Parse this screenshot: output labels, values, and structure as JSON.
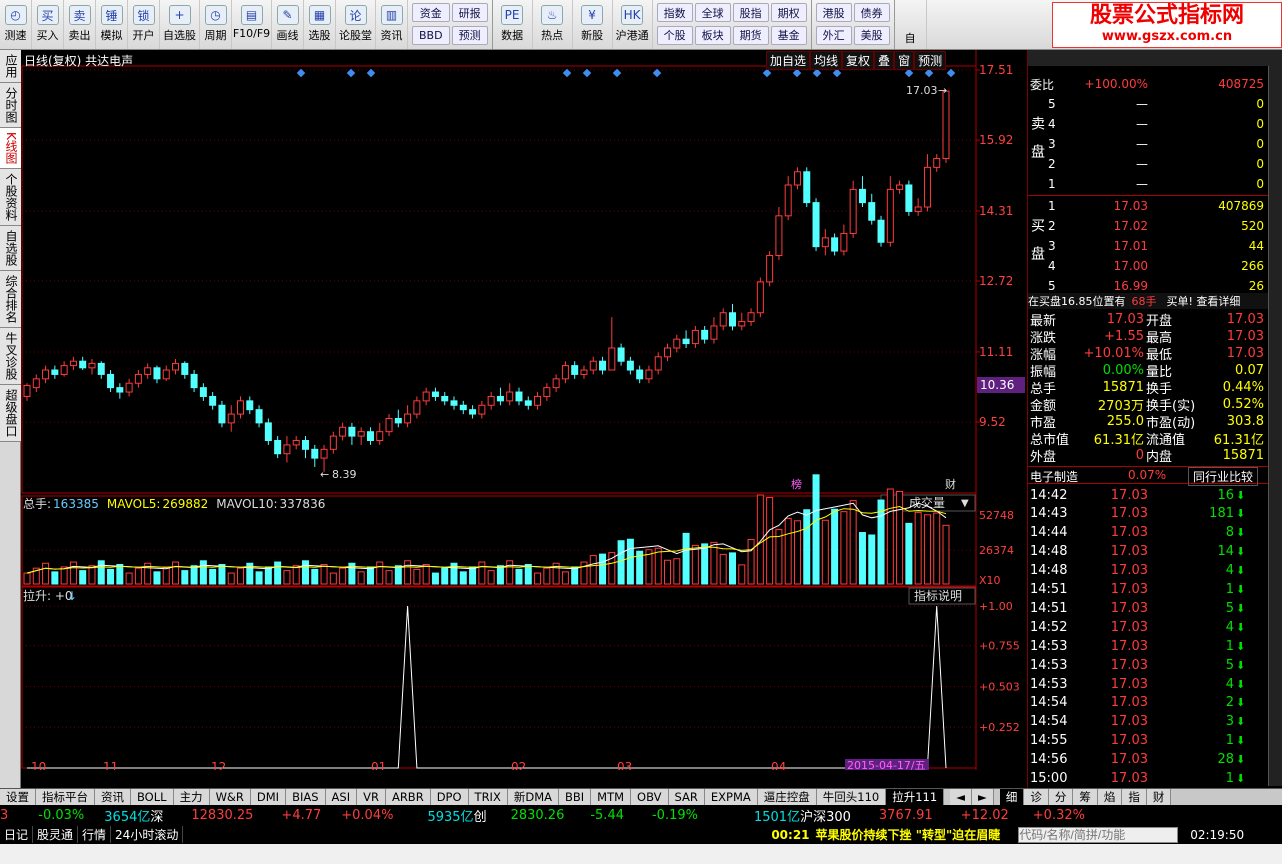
{
  "toolbar": {
    "buttons": [
      {
        "label": "测速",
        "icon": "clock-icon"
      },
      {
        "label": "买入",
        "icon": "buy-icon",
        "glyph": "买"
      },
      {
        "label": "卖出",
        "icon": "sell-icon",
        "glyph": "卖"
      },
      {
        "label": "模拟",
        "icon": "hammer-icon",
        "glyph": "锤"
      },
      {
        "label": "开户",
        "icon": "lock-icon",
        "glyph": "锁"
      },
      {
        "label": "自选股",
        "icon": "folder-plus-icon",
        "glyph": "+"
      },
      {
        "label": "周期",
        "icon": "clock-cycle-icon",
        "glyph": "◷"
      },
      {
        "label": "F10/F9",
        "icon": "f10-icon",
        "glyph": "▤"
      },
      {
        "label": "画线",
        "icon": "pen-icon",
        "glyph": "✎"
      },
      {
        "label": "选股",
        "icon": "select-stock-icon",
        "glyph": "▦"
      },
      {
        "label": "论股堂",
        "icon": "forum-icon",
        "glyph": "论"
      },
      {
        "label": "资讯",
        "icon": "news-icon",
        "glyph": "▥"
      }
    ],
    "group1": [
      "资金",
      "研报",
      "BBD",
      "预测"
    ],
    "group2": [
      {
        "label": "数据",
        "glyph": "PE"
      },
      {
        "label": "热点",
        "glyph": "♨"
      },
      {
        "label": "新股",
        "glyph": "¥"
      },
      {
        "label": "沪港通",
        "glyph": "HK"
      }
    ],
    "group3": [
      "指数",
      "全球",
      "股指",
      "期权",
      "个股",
      "板块",
      "期货",
      "基金"
    ],
    "group4": [
      "港股",
      "债券",
      "外汇",
      "美股"
    ],
    "last": "自"
  },
  "logo": {
    "line1": "股票公式指标网",
    "line2": "www.gszx.com.cn"
  },
  "sidebar": [
    "应用",
    "分时图",
    "K线图",
    "个股资料",
    "自选股",
    "综合排名",
    "牛叉诊股",
    "超级盘口"
  ],
  "chart": {
    "title": "日线(复权)  共达电声",
    "tools": [
      "加自选",
      "均线",
      "复权",
      "叠",
      "窗",
      "预测"
    ],
    "price_axis": [
      "17.51",
      "15.92",
      "14.31",
      "12.72",
      "11.11",
      "9.52"
    ],
    "current_price_tag": "10.36",
    "high_label": "17.03",
    "low_label": "8.39",
    "mark_bang": "榜",
    "mark_cai": "财",
    "vol_legend": {
      "name": "总手:",
      "val": "163385",
      "ma5": "MAVOL5:",
      "ma5v": "269882",
      "ma10": "MAVOL10:",
      "ma10v": "337836"
    },
    "vol_axis": [
      "52748",
      "26374",
      "X10"
    ],
    "vol_button": "成交量",
    "ind_legend": "拉升: +0",
    "ind_button": "指标说明",
    "ind_axis": [
      "+1.00",
      "+0.755",
      "+0.503",
      "+0.252"
    ],
    "date_axis": [
      "10",
      "11",
      "12",
      "01",
      "02",
      "03",
      "04"
    ],
    "date_hover": "2015-04-17/五",
    "colors": {
      "up": "#ff3c3c",
      "down": "#54ffff",
      "grid": "#6e0000",
      "axis": "#b00000"
    }
  },
  "quote": {
    "weibi_label": "委比",
    "weibi_pct": "+100.00%",
    "weibi_diff": "408725",
    "sell_label": "卖盘",
    "sells": [
      {
        "n": "5",
        "p": "—",
        "v": "0"
      },
      {
        "n": "4",
        "p": "—",
        "v": "0"
      },
      {
        "n": "3",
        "p": "—",
        "v": "0"
      },
      {
        "n": "2",
        "p": "—",
        "v": "0"
      },
      {
        "n": "1",
        "p": "—",
        "v": "0"
      }
    ],
    "buy_label": "买盘",
    "buys": [
      {
        "n": "1",
        "p": "17.03",
        "v": "407869"
      },
      {
        "n": "2",
        "p": "17.02",
        "v": "520"
      },
      {
        "n": "3",
        "p": "17.01",
        "v": "44"
      },
      {
        "n": "4",
        "p": "17.00",
        "v": "266"
      },
      {
        "n": "5",
        "p": "16.99",
        "v": "26"
      }
    ],
    "zmp": "在买盘16.85位置有",
    "zmp_v": "68手",
    "zmp_link": "买单! 查看详细",
    "stats": [
      [
        "最新",
        "17.03",
        "开盘",
        "17.03"
      ],
      [
        "涨跌",
        "+1.55",
        "最高",
        "17.03"
      ],
      [
        "涨幅",
        "+10.01%",
        "最低",
        "17.03"
      ],
      [
        "振幅",
        "0.00%",
        "量比",
        "0.07"
      ],
      [
        "总手",
        "15871",
        "换手",
        "0.44%"
      ],
      [
        "金额",
        "2703万",
        "换手(实)",
        "0.52%"
      ],
      [
        "市盈",
        "255.0",
        "市盈(动)",
        "303.8"
      ],
      [
        "总市值",
        "61.31亿",
        "流通值",
        "61.31亿"
      ],
      [
        "外盘",
        "0",
        "内盘",
        "15871"
      ]
    ],
    "industry": "电子制造",
    "industry_pct": "0.07%",
    "compare": "同行业比较",
    "ticks": [
      {
        "t": "14:42",
        "p": "17.03",
        "v": "16"
      },
      {
        "t": "14:43",
        "p": "17.03",
        "v": "181"
      },
      {
        "t": "14:44",
        "p": "17.03",
        "v": "8"
      },
      {
        "t": "14:48",
        "p": "17.03",
        "v": "14"
      },
      {
        "t": "14:48",
        "p": "17.03",
        "v": "4"
      },
      {
        "t": "14:51",
        "p": "17.03",
        "v": "1"
      },
      {
        "t": "14:51",
        "p": "17.03",
        "v": "5"
      },
      {
        "t": "14:52",
        "p": "17.03",
        "v": "4"
      },
      {
        "t": "14:53",
        "p": "17.03",
        "v": "1"
      },
      {
        "t": "14:53",
        "p": "17.03",
        "v": "5"
      },
      {
        "t": "14:53",
        "p": "17.03",
        "v": "4"
      },
      {
        "t": "14:54",
        "p": "17.03",
        "v": "2"
      },
      {
        "t": "14:54",
        "p": "17.03",
        "v": "3"
      },
      {
        "t": "14:55",
        "p": "17.03",
        "v": "1"
      },
      {
        "t": "14:56",
        "p": "17.03",
        "v": "28"
      },
      {
        "t": "15:00",
        "p": "17.03",
        "v": "1"
      }
    ]
  },
  "tabs": [
    "设置",
    "指标平台",
    "资讯",
    "BOLL",
    "主力",
    "W&R",
    "DMI",
    "BIAS",
    "ASI",
    "VR",
    "ARBR",
    "DPO",
    "TRIX",
    "新DMA",
    "BBI",
    "MTM",
    "OBV",
    "SAR",
    "EXPMA",
    "逼庄控盘",
    "牛回头110",
    "拉升111"
  ],
  "right_tabs": [
    "细",
    "诊",
    "分",
    "筹",
    "焰",
    "指",
    "财"
  ],
  "index_bar": [
    {
      "t": "3",
      "c": "red"
    },
    {
      "t": "-0.03%",
      "c": "grn"
    },
    {
      "t": "3654亿",
      "c": "cyn"
    },
    {
      "t": "深",
      "c": "wht"
    },
    {
      "t": "12830.25",
      "c": "red"
    },
    {
      "t": "+4.77",
      "c": "red"
    },
    {
      "t": "+0.04%",
      "c": "red"
    },
    {
      "t": "5935亿",
      "c": "cyn"
    },
    {
      "t": "创",
      "c": "wht"
    },
    {
      "t": "2830.26",
      "c": "grn"
    },
    {
      "t": "-5.44",
      "c": "grn"
    },
    {
      "t": "-0.19%",
      "c": "grn"
    },
    {
      "t": "1501亿",
      "c": "cyn"
    },
    {
      "t": "沪深300",
      "c": "wht"
    },
    {
      "t": "3767.91",
      "c": "red"
    },
    {
      "t": "+12.02",
      "c": "red"
    },
    {
      "t": "+0.32%",
      "c": "red"
    }
  ],
  "status": {
    "items": [
      "日记",
      "股灵通",
      "行情",
      "24小时滚动"
    ],
    "news_time": "00:21",
    "news": "苹果股价持续下挫 \"转型\"迫在眉睫",
    "search_placeholder": "代码/名称/简拼/功能",
    "clock": "02:19:50"
  }
}
